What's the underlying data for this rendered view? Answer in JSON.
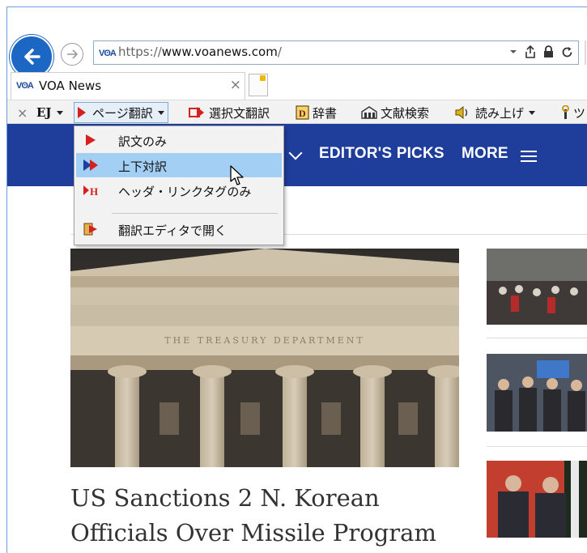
{
  "browser": {
    "address": {
      "favicon_text": "VʘA",
      "url_prefix": "https://",
      "url_host": "www.voanews.com",
      "url_suffix": "/"
    },
    "tab": {
      "favicon_text": "VʘA",
      "title": "VOA News",
      "close": "×"
    }
  },
  "toolbar": {
    "close": "×",
    "ej": "EJ",
    "page_translate": "ページ翻訳",
    "selection_translate": "選択文翻訳",
    "dictionary": "辞書",
    "literature_search": "文献検索",
    "read_aloud": "読み上げ",
    "tool": "ツ"
  },
  "menu": {
    "items": [
      {
        "label": "訳文のみ"
      },
      {
        "label": "上下対訳"
      },
      {
        "label": "ヘッダ・リンクタグのみ"
      },
      {
        "label": "翻訳エディタで開く"
      }
    ],
    "highlighted_index": 1
  },
  "site": {
    "nav": {
      "editors_picks": "EDITOR'S PICKS",
      "more": "MORE"
    },
    "hero": {
      "inscription": "THE TREASURY DEPARTMENT",
      "headline_line1": "US Sanctions 2 N. Korean",
      "headline_line2": "Officials Over Missile Program"
    }
  },
  "colors": {
    "accent_blue": "#1f3d9b",
    "menu_highlight": "#a3cff5",
    "brand_red": "#d61f1f"
  }
}
